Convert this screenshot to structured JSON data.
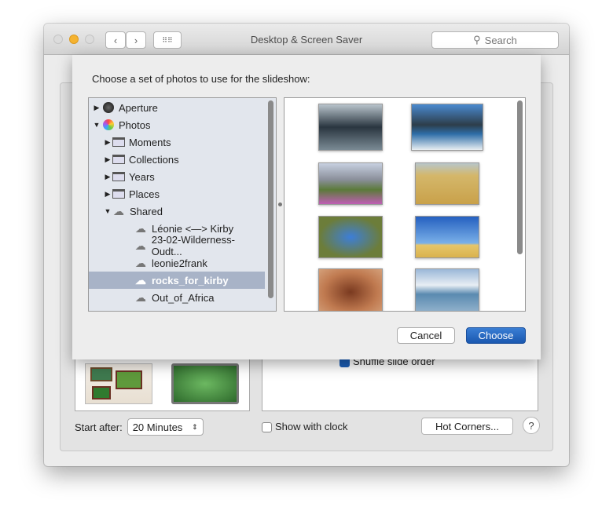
{
  "window": {
    "title": "Desktop & Screen Saver",
    "search_placeholder": "Search"
  },
  "sheet": {
    "prompt": "Choose a set of photos to use for the slideshow:",
    "tree": [
      {
        "label": "Aperture",
        "level": 0,
        "disclosure": "collapsed",
        "icon": "aperture-icon"
      },
      {
        "label": "Photos",
        "level": 0,
        "disclosure": "expanded",
        "icon": "photos-icon"
      },
      {
        "label": "Moments",
        "level": 1,
        "disclosure": "collapsed",
        "icon": "folder-icon"
      },
      {
        "label": "Collections",
        "level": 1,
        "disclosure": "collapsed",
        "icon": "folder-icon"
      },
      {
        "label": "Years",
        "level": 1,
        "disclosure": "collapsed",
        "icon": "folder-icon"
      },
      {
        "label": "Places",
        "level": 1,
        "disclosure": "collapsed",
        "icon": "folder-icon"
      },
      {
        "label": "Shared",
        "level": 1,
        "disclosure": "expanded",
        "icon": "cloud-icon"
      },
      {
        "label": "Léonie <—> Kirby",
        "level": 2,
        "icon": "cloud-icon"
      },
      {
        "label": "23-02-Wilderness-Oudt...",
        "level": 2,
        "icon": "cloud-icon"
      },
      {
        "label": "leonie2frank",
        "level": 2,
        "icon": "cloud-icon"
      },
      {
        "label": "rocks_for_kirby",
        "level": 2,
        "icon": "cloud-icon",
        "selected": true
      },
      {
        "label": "Out_of_Africa",
        "level": 2,
        "icon": "cloud-icon"
      }
    ],
    "cancel": "Cancel",
    "choose": "Choose"
  },
  "bottom": {
    "shuffle": "Shuffle slide order",
    "start_after_label": "Start after:",
    "start_after_value": "20 Minutes",
    "show_clock": "Show with clock",
    "hot_corners": "Hot Corners...",
    "help": "?"
  },
  "colors": {
    "accent": "#1d5fb8",
    "selection": "#a8b3c7"
  }
}
